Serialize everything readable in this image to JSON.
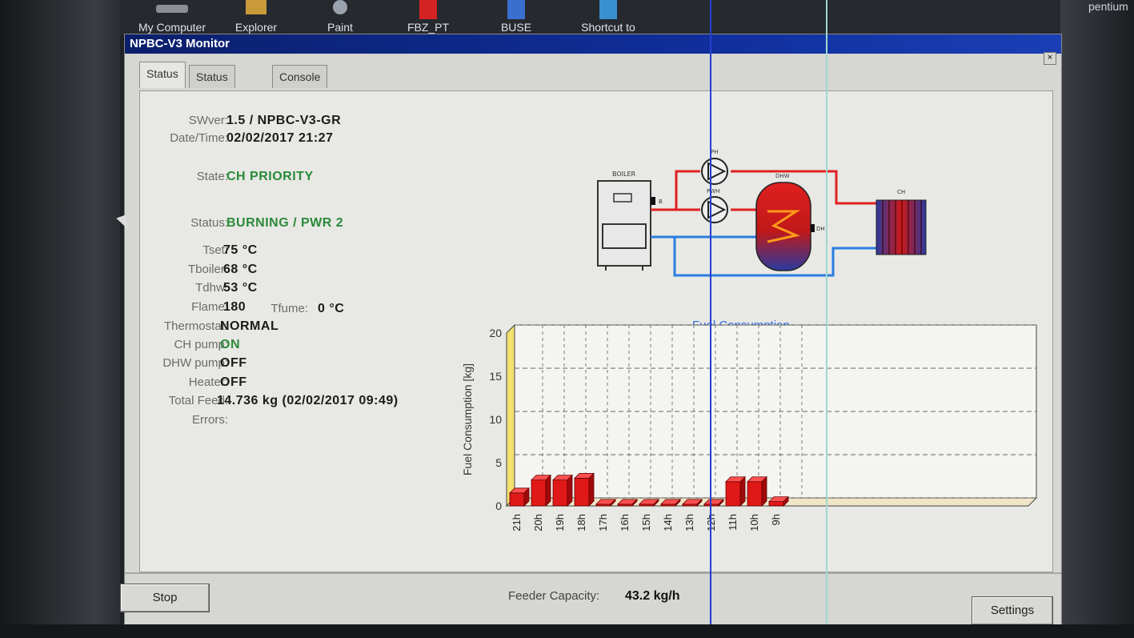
{
  "desktop": {
    "icons": [
      {
        "label": "My Computer",
        "icon": "computer-icon"
      },
      {
        "label": "Explorer",
        "icon": "explorer-icon"
      },
      {
        "label": "Paint",
        "icon": "paint-icon"
      },
      {
        "label": "FBZ_PT",
        "icon": "shortcut-icon"
      },
      {
        "label": "BUSE",
        "icon": "shortcut-icon"
      },
      {
        "label": "Shortcut to",
        "icon": "shortcut-icon"
      }
    ],
    "sticker": "pentium"
  },
  "window": {
    "title": "NPBC-V3 Monitor",
    "tabs": [
      {
        "label": "Status",
        "active": true
      },
      {
        "label": "Status Chart",
        "active": false
      },
      {
        "label": "Console",
        "active": false
      }
    ]
  },
  "status": {
    "swver_label": "SWver:",
    "swver": "1.5 / NPBC-V3-GR",
    "datetime_label": "Date/Time:",
    "datetime": "02/02/2017 21:27",
    "state_label": "State:",
    "state": "CH PRIORITY",
    "status_label": "Status:",
    "status": "BURNING / PWR 2",
    "tset_label": "Tset:",
    "tset": "75 °C",
    "tboiler_label": "Tboiler:",
    "tboiler": "68 °C",
    "tdhw_label": "Tdhw:",
    "tdhw": "53 °C",
    "flame_label": "Flame:",
    "flame": "180",
    "tfume_label": "Tfume:",
    "tfume": "0 °C",
    "thermostat_label": "Thermostat:",
    "thermostat": "NORMAL",
    "chpump_label": "CH pump:",
    "chpump": "ON",
    "dhwpump_label": "DHW pump:",
    "dhwpump": "OFF",
    "heater_label": "Heater:",
    "heater": "OFF",
    "totalfeed_label": "Total Feed:",
    "totalfeed": "14.736 kg (02/02/2017 09:49)",
    "errors_label": "Errors:",
    "errors": ""
  },
  "diagram": {
    "boiler_label": "BOILER",
    "ph_label": "PH",
    "pwh_label": "PWH",
    "dhw_label": "DHW",
    "ch_label": "CH",
    "b_label": "B",
    "dhw_sensor_label": "DH",
    "colors": {
      "hot": "#e02020",
      "cold": "#2a7de0"
    }
  },
  "chart_data": {
    "type": "bar",
    "title": "Fuel Consumption",
    "ylabel": "Fuel Consumption [kg]",
    "xlabel": "",
    "categories": [
      "21h",
      "20h",
      "19h",
      "18h",
      "17h",
      "16h",
      "15h",
      "14h",
      "13h",
      "12h",
      "11h",
      "10h",
      "9h"
    ],
    "values": [
      1.5,
      3.0,
      3.0,
      3.2,
      0.2,
      0.2,
      0.2,
      0.2,
      0.2,
      0.2,
      2.8,
      2.8,
      0.5
    ],
    "ylim": [
      0,
      20
    ],
    "yticks": [
      0,
      5,
      10,
      15,
      20
    ],
    "grid": true,
    "colors": {
      "bar": "#e01818",
      "bar_top": "#ff5050",
      "bar_side": "#a00a0a"
    }
  },
  "feeder": {
    "label": "Feeder Capacity:",
    "value": "43.2 kg/h"
  },
  "buttons": {
    "stop": "Stop",
    "settings": "Settings"
  }
}
